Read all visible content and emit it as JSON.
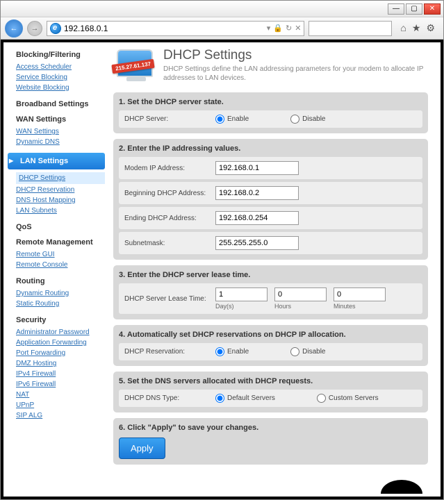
{
  "browser": {
    "url": "192.168.0.1"
  },
  "page": {
    "title": "DHCP Settings",
    "subtitle": "DHCP Settings define the LAN addressing parameters for your modem to allocate IP addresses to LAN devices.",
    "logo_ip": "215.27.61.137"
  },
  "sidebar": {
    "blocking": {
      "heading": "Blocking/Filtering",
      "links": [
        "Access Scheduler",
        "Service Blocking",
        "Website Blocking"
      ]
    },
    "broadband": {
      "heading": "Broadband Settings"
    },
    "wan": {
      "heading": "WAN Settings",
      "links": [
        "WAN Settings",
        "Dynamic DNS"
      ]
    },
    "lan": {
      "heading": "LAN Settings",
      "active": "DHCP Settings",
      "links": [
        "DHCP Reservation",
        "DNS Host Mapping",
        "LAN Subnets"
      ]
    },
    "qos": {
      "heading": "QoS"
    },
    "remote": {
      "heading": "Remote Management",
      "links": [
        "Remote GUI",
        "Remote Console"
      ]
    },
    "routing": {
      "heading": "Routing",
      "links": [
        "Dynamic Routing",
        "Static Routing"
      ]
    },
    "security": {
      "heading": "Security",
      "links": [
        "Administrator Password",
        "Application Forwarding",
        "Port Forwarding",
        "DMZ Hosting",
        "IPv4 Firewall",
        "IPv6 Firewall",
        "NAT",
        "UPnP",
        "SIP ALG"
      ]
    }
  },
  "sections": {
    "s1": {
      "title": "1. Set the DHCP server state.",
      "label": "DHCP Server:",
      "enable": "Enable",
      "disable": "Disable"
    },
    "s2": {
      "title": "2. Enter the IP addressing values.",
      "modem_label": "Modem IP Address:",
      "modem_val": "192.168.0.1",
      "begin_label": "Beginning DHCP Address:",
      "begin_val": "192.168.0.2",
      "end_label": "Ending DHCP Address:",
      "end_val": "192.168.0.254",
      "mask_label": "Subnetmask:",
      "mask_val": "255.255.255.0"
    },
    "s3": {
      "title": "3. Enter the DHCP server lease time.",
      "label": "DHCP Server Lease Time:",
      "days_val": "1",
      "days_lbl": "Day(s)",
      "hours_val": "0",
      "hours_lbl": "Hours",
      "mins_val": "0",
      "mins_lbl": "Minutes"
    },
    "s4": {
      "title": "4. Automatically set DHCP reservations on DHCP IP allocation.",
      "label": "DHCP Reservation:",
      "enable": "Enable",
      "disable": "Disable"
    },
    "s5": {
      "title": "5. Set the DNS servers allocated with DHCP requests.",
      "label": "DHCP DNS Type:",
      "default": "Default Servers",
      "custom": "Custom Servers"
    },
    "s6": {
      "title": "6. Click \"Apply\" to save your changes.",
      "button": "Apply"
    }
  }
}
